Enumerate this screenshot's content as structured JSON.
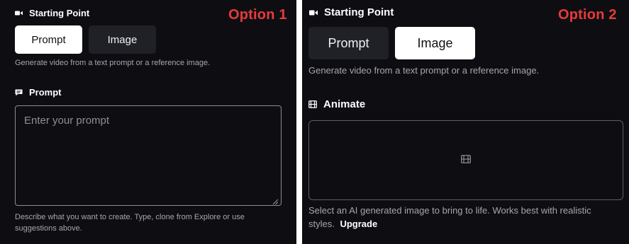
{
  "colors": {
    "panel_bg": "#0e0d12",
    "option_label": "#e83a3a",
    "active_button_bg": "#ffffff",
    "inactive_button_bg": "#202027",
    "helper_text": "#a6a6ad"
  },
  "option1": {
    "label": "Option 1",
    "starting_point": {
      "title": "Starting Point",
      "icon": "video-camera-icon",
      "tabs": [
        {
          "label": "Prompt",
          "active": true
        },
        {
          "label": "Image",
          "active": false
        }
      ],
      "helper": "Generate video from a text prompt or a reference image."
    },
    "prompt": {
      "title": "Prompt",
      "icon": "message-icon",
      "placeholder": "Enter your prompt",
      "helper": "Describe what you want to create. Type, clone from Explore or use suggestions above."
    }
  },
  "option2": {
    "label": "Option 2",
    "starting_point": {
      "title": "Starting Point",
      "icon": "video-camera-icon",
      "tabs": [
        {
          "label": "Prompt",
          "active": false
        },
        {
          "label": "Image",
          "active": true
        }
      ],
      "helper": "Generate video from a text prompt or a reference image."
    },
    "animate": {
      "title": "Animate",
      "icon": "film-icon",
      "dropzone_icon": "film-icon",
      "helper": "Select an AI generated image to bring to life. Works best with realistic styles.",
      "upgrade_label": "Upgrade"
    }
  }
}
